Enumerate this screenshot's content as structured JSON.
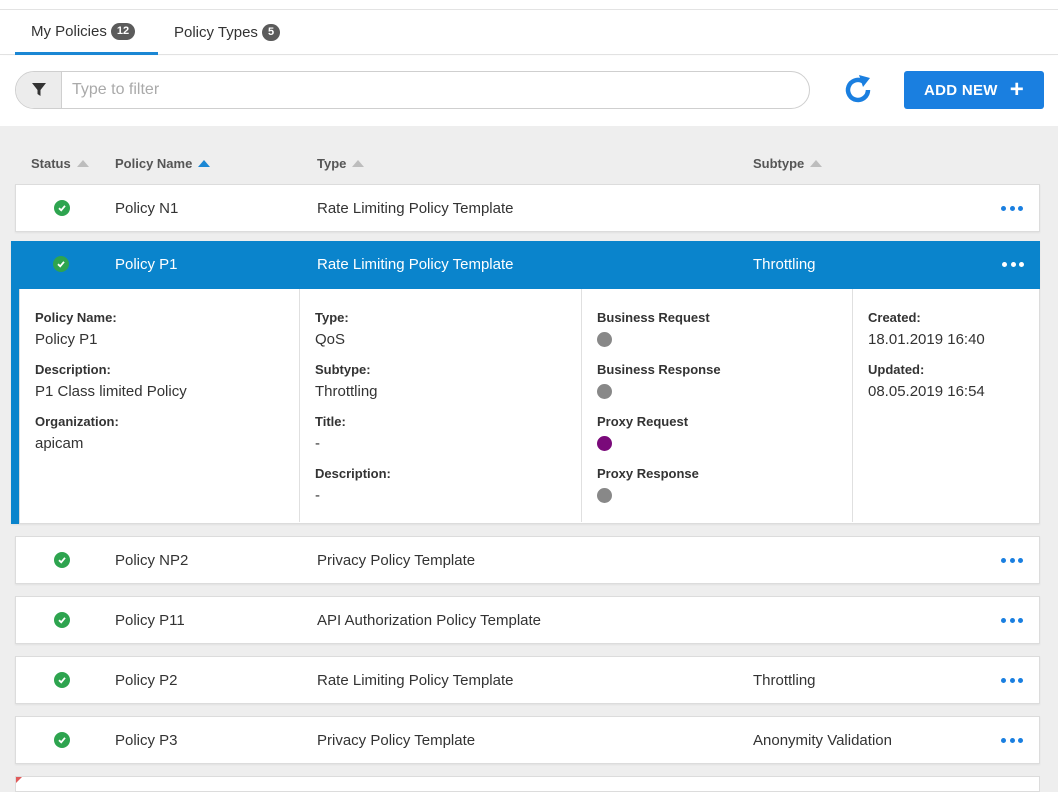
{
  "tabs": [
    {
      "label": "My Policies",
      "count": "12"
    },
    {
      "label": "Policy Types",
      "count": "5"
    }
  ],
  "filter": {
    "placeholder": "Type to filter"
  },
  "add_button": {
    "label": "ADD NEW",
    "icon": "plus-icon"
  },
  "refresh_icon": "refresh-icon",
  "columns": [
    {
      "label": "Status"
    },
    {
      "label": "Policy Name"
    },
    {
      "label": "Type"
    },
    {
      "label": "Subtype"
    }
  ],
  "sorted_column": "Policy Name",
  "rows": [
    {
      "name": "Policy N1",
      "type": "Rate Limiting Policy Template",
      "subtype": ""
    },
    {
      "name": "Policy P1",
      "type": "Rate Limiting Policy Template",
      "subtype": "Throttling"
    },
    {
      "name": "Policy NP2",
      "type": "Privacy Policy Template",
      "subtype": ""
    },
    {
      "name": "Policy P11",
      "type": "API Authorization Policy Template",
      "subtype": ""
    },
    {
      "name": "Policy P2",
      "type": "Rate Limiting Policy Template",
      "subtype": "Throttling"
    },
    {
      "name": "Policy P3",
      "type": "Privacy Policy Template",
      "subtype": "Anonymity Validation"
    }
  ],
  "detail": {
    "policy_name_label": "Policy Name:",
    "policy_name": "Policy P1",
    "description_label": "Description:",
    "description": "P1 Class limited Policy",
    "organization_label": "Organization:",
    "organization": "apicam",
    "type_label": "Type:",
    "type": "QoS",
    "subtype_label": "Subtype:",
    "subtype": "Throttling",
    "title_label": "Title:",
    "title": "-",
    "type_description_label": "Description:",
    "type_description": "-",
    "business_request_label": "Business Request",
    "business_response_label": "Business Response",
    "proxy_request_label": "Proxy Request",
    "proxy_response_label": "Proxy Response",
    "created_label": "Created:",
    "created": "18.01.2019 16:40",
    "updated_label": "Updated:",
    "updated": "08.05.2019 16:54"
  },
  "colors": {
    "accent": "#1a7fe0",
    "selected_row": "#0a84cc",
    "status_ok": "#2ea44f",
    "indicator_off": "#888888",
    "indicator_proxy_request": "#7a0a7a"
  }
}
